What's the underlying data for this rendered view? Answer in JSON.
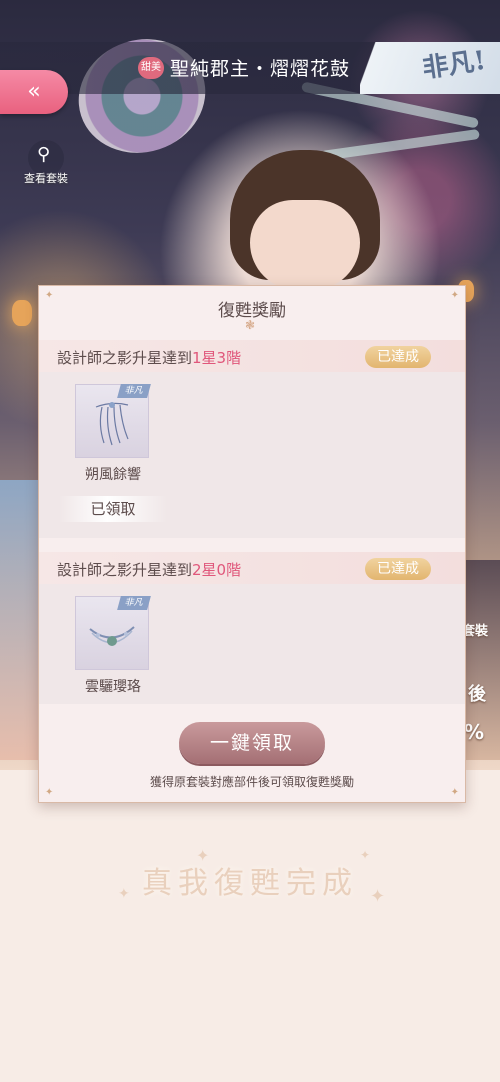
{
  "header": {
    "rarity_badge": "甜美",
    "suit_title": "聖純郡主・熠熠花鼓",
    "tier_label": "非凡!",
    "back_icon": "double-chevron-left",
    "view_suit_label": "查看套裝"
  },
  "background": {
    "right_edge_texts": [
      "套裝",
      "後",
      "%"
    ]
  },
  "panel": {
    "title": "復甦獎勵",
    "sections": [
      {
        "condition_prefix": "設計師之影升星達到",
        "condition_highlight": "1星3階",
        "status": "已達成",
        "reward_name": "朔風餘響",
        "reward_tag": "非凡",
        "claim_status": "已領取"
      },
      {
        "condition_prefix": "設計師之影升星達到",
        "condition_highlight": "2星0階",
        "status": "已達成",
        "reward_name": "雲驪瓔珞",
        "reward_tag": "非凡"
      }
    ],
    "claim_all_label": "一鍵領取",
    "hint": "獲得原套裝對應部件後可領取復甦獎勵"
  },
  "footer": {
    "title": "真我復甦完成"
  },
  "colors": {
    "accent_pink": "#e9617f",
    "highlight_text": "#e0577b",
    "achieved_gold": "#e2b56f"
  }
}
